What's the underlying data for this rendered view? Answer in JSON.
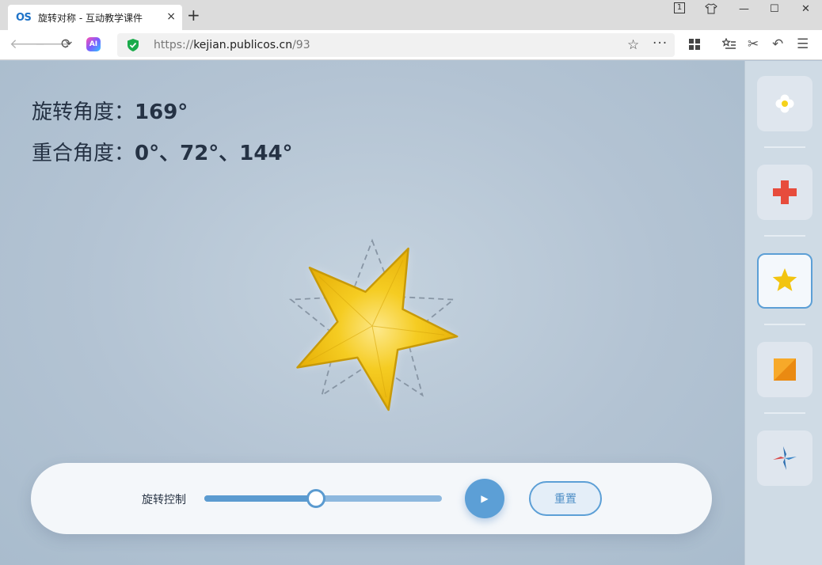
{
  "browser": {
    "tab_logo": "OS",
    "tab_title": "旋转对称 - 互动教学课件",
    "tab_close": "×",
    "new_tab": "+",
    "tab_count": "1",
    "url_scheme": "https://",
    "url_host": "kejian.publicos.cn",
    "url_path": "/93",
    "ai_label": "AI",
    "more_glyph": "···",
    "window_controls": {
      "minimize": "—",
      "maximize": "☐",
      "close": "✕"
    },
    "colors": {
      "tab_logo": "#1e73c8",
      "shield": "#1aab4b"
    }
  },
  "info": {
    "rotation_label": "旋转角度：",
    "rotation_value": "169°",
    "overlap_label": "重合角度：",
    "overlap_value": "0°、72°、144°"
  },
  "shape": {
    "name": "star",
    "points": 5,
    "rotation_deg": 169,
    "colors": {
      "fill": "#f2c410",
      "stroke": "#c89a08",
      "ghost": "#8795a4"
    }
  },
  "controls": {
    "label": "旋转控制",
    "slider_fraction": 0.469,
    "play_icon": "▶",
    "reset_label": "重置"
  },
  "sidebar": {
    "items": [
      {
        "name": "flower",
        "icon": "flower-icon",
        "active": false
      },
      {
        "name": "cross",
        "icon": "red-cross-icon",
        "active": false,
        "color": "#e74c3c"
      },
      {
        "name": "star",
        "icon": "star-icon",
        "active": true,
        "color": "#f2c410"
      },
      {
        "name": "square",
        "icon": "orange-square-icon",
        "active": false,
        "color": "#f39c12"
      },
      {
        "name": "pinwheel",
        "icon": "pinwheel-icon",
        "active": false,
        "color": "#3a86c8"
      }
    ]
  }
}
